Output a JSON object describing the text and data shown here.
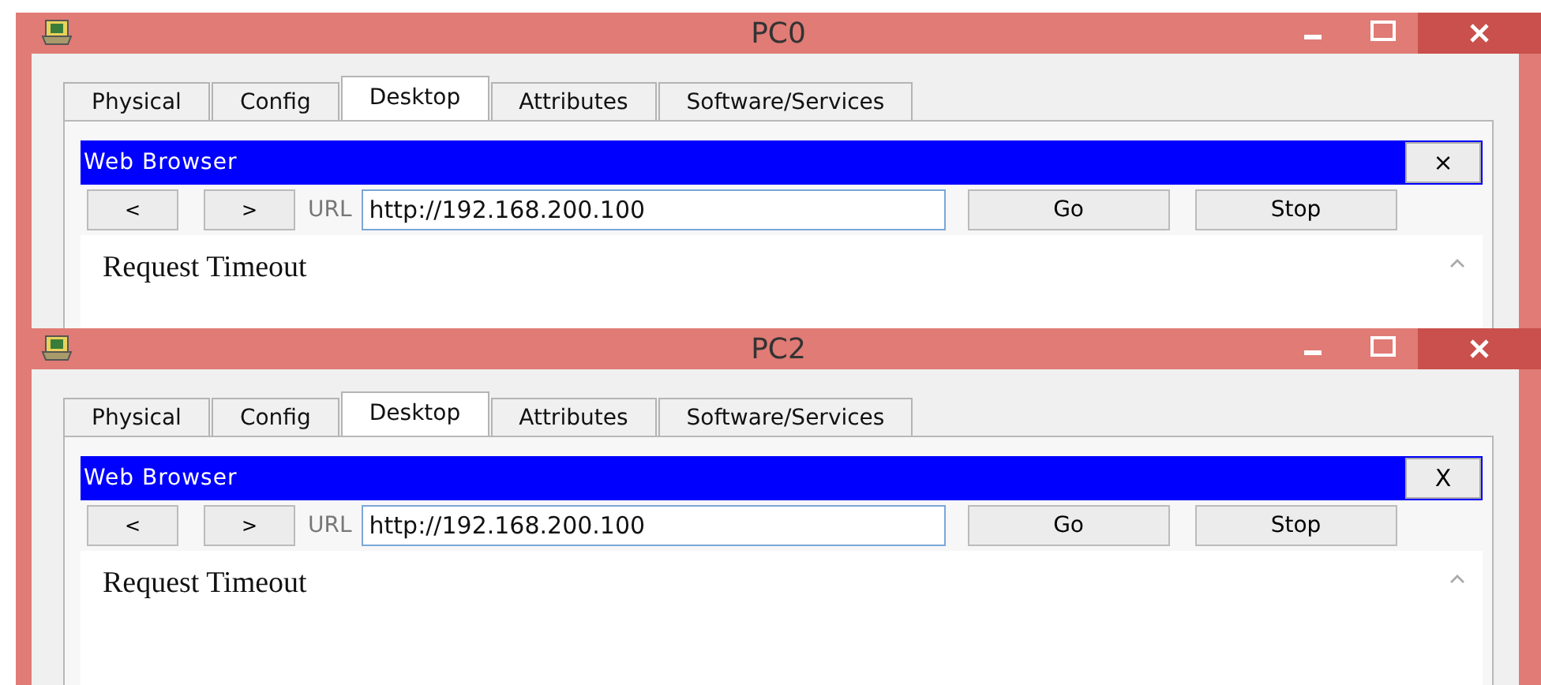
{
  "windows": [
    {
      "title": "PC0",
      "tabs": [
        {
          "label": "Physical",
          "selected": false
        },
        {
          "label": "Config",
          "selected": false
        },
        {
          "label": "Desktop",
          "selected": true
        },
        {
          "label": "Attributes",
          "selected": false
        },
        {
          "label": "Software/Services",
          "selected": false
        }
      ],
      "browser": {
        "title": "Web Browser",
        "close": "×",
        "back": "<",
        "forward": ">",
        "url_label": "URL",
        "url": "http://192.168.200.100",
        "go": "Go",
        "stop": "Stop",
        "content": "Request Timeout"
      }
    },
    {
      "title": "PC2",
      "tabs": [
        {
          "label": "Physical",
          "selected": false
        },
        {
          "label": "Config",
          "selected": false
        },
        {
          "label": "Desktop",
          "selected": true
        },
        {
          "label": "Attributes",
          "selected": false
        },
        {
          "label": "Software/Services",
          "selected": false
        }
      ],
      "browser": {
        "title": "Web Browser",
        "close": "X",
        "back": "<",
        "forward": ">",
        "url_label": "URL",
        "url": "http://192.168.200.100",
        "go": "Go",
        "stop": "Stop",
        "content": "Request Timeout"
      }
    }
  ]
}
